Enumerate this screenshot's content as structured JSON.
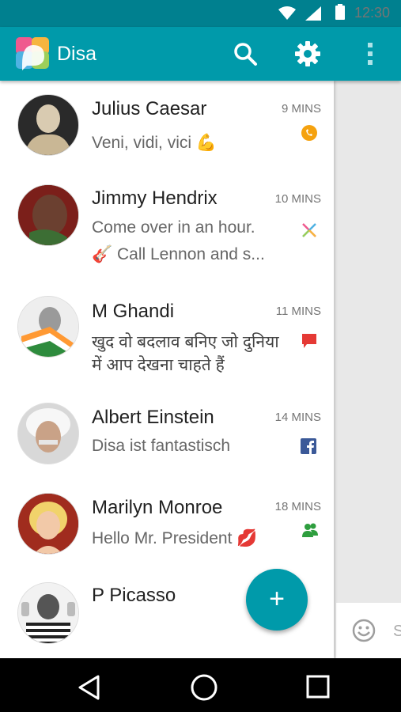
{
  "status_bar": {
    "time": "12:30"
  },
  "app_bar": {
    "title": "Disa"
  },
  "conversations": [
    {
      "name": "Julius Caesar",
      "time": "9 MINS",
      "preview": "Veni, vidi, vici 💪",
      "service": "whatsapp"
    },
    {
      "name": "Jimmy Hendrix",
      "time": "10 MINS",
      "preview": "Come over in an hour.",
      "preview2": "🎸 Call Lennon and s...",
      "service": "multi"
    },
    {
      "name": "M Ghandi",
      "time": "11 MINS",
      "preview": "खुद वो बदलाव बनिए जो दुनिया",
      "preview2": "में आप देखना चाहते हैं",
      "service": "sms"
    },
    {
      "name": "Albert Einstein",
      "time": "14 MINS",
      "preview": "Disa ist fantastisch",
      "service": "facebook"
    },
    {
      "name": "Marilyn Monroe",
      "time": "18 MINS",
      "preview": "Hello Mr. President 💋",
      "service": "group"
    },
    {
      "name": "P Picasso",
      "time": "",
      "preview": "",
      "service": "multi"
    }
  ],
  "fab": {
    "icon": "+"
  },
  "composer": {
    "placeholder_fragment": "S"
  },
  "colors": {
    "primary": "#009aaa",
    "status": "#00808f"
  }
}
